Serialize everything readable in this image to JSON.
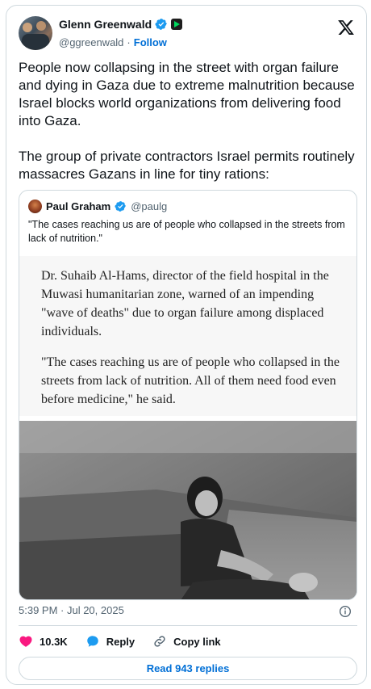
{
  "author": {
    "name": "Glenn Greenwald",
    "handle": "@ggreenwald",
    "separator": "·",
    "follow_label": "Follow"
  },
  "tweet_text": "People now collapsing in the street with organ failure and dying in Gaza due to extreme malnutrition because Israel blocks world organizations from delivering food into Gaza.\n\nThe group of private contractors Israel permits routinely massacres Gazans in line for tiny rations:",
  "quote": {
    "name": "Paul Graham",
    "handle": "@paulg",
    "text": "\"The cases reaching us are of people who collapsed in the streets from lack of nutrition.\"",
    "article_paragraph_1": "Dr. Suhaib Al-Hams, director of the field hospital in the Muwasi humanitarian zone, warned of an impending \"wave of deaths\" due to organ failure among displaced individuals.",
    "article_paragraph_2": "\"The cases reaching us are of people who collapsed in the streets from lack of nutrition. All of them need food even before medicine,\" he said."
  },
  "timestamp": "5:39 PM · Jul 20, 2025",
  "actions": {
    "likes": "10.3K",
    "reply_label": "Reply",
    "copy_link_label": "Copy link"
  },
  "read_replies_label": "Read 943 replies",
  "colors": {
    "accent": "#006fd6",
    "like": "#f91880",
    "verified": "#1d9bf0",
    "border": "#cfd9de",
    "muted": "#536471"
  },
  "icons": [
    "verified-badge-icon",
    "affiliate-badge-icon",
    "x-logo-icon",
    "info-icon",
    "heart-icon",
    "reply-bubble-icon",
    "link-icon"
  ]
}
